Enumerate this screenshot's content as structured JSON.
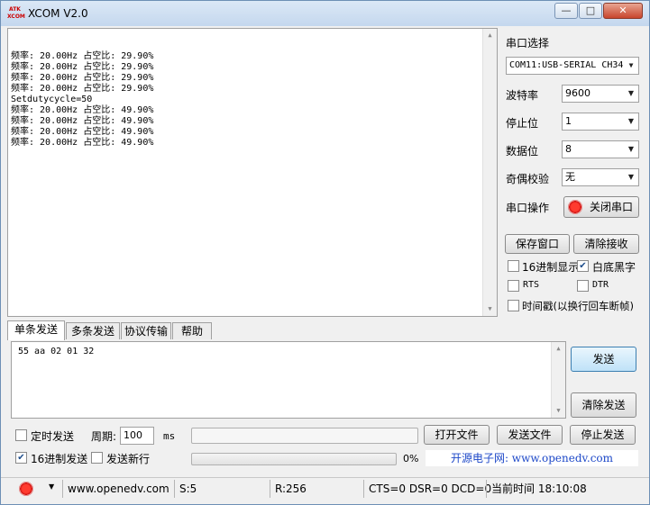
{
  "window": {
    "title": "XCOM V2.0",
    "logo_text": "ATK XCOM",
    "minimize_icon": "minimize-icon",
    "maximize_icon": "maximize-icon",
    "close_icon": "close-icon",
    "minimize_glyph": "—",
    "maximize_glyph": "□",
    "close_glyph": "✕"
  },
  "receive": {
    "lines": [
      "频率: 20.00Hz 占空比: 29.90%",
      "频率: 20.00Hz 占空比: 29.90%",
      "频率: 20.00Hz 占空比: 29.90%",
      "频率: 20.00Hz 占空比: 29.90%",
      "Setdutycycle=50",
      "频率: 20.00Hz 占空比: 49.90%",
      "频率: 20.00Hz 占空比: 49.90%",
      "频率: 20.00Hz 占空比: 49.90%",
      "频率: 20.00Hz 占空比: 49.90%"
    ]
  },
  "settings": {
    "port_select_label": "串口选择",
    "port_value": "COM11:USB-SERIAL CH34",
    "baud_label": "波特率",
    "baud_value": "9600",
    "stopbit_label": "停止位",
    "stopbit_value": "1",
    "databit_label": "数据位",
    "databit_value": "8",
    "parity_label": "奇偶校验",
    "parity_value": "无",
    "port_op_label": "串口操作",
    "close_port_button": "关闭串口",
    "save_window_button": "保存窗口",
    "clear_receive_button": "清除接收",
    "hex_display_label": "16进制显示",
    "hex_display_checked": false,
    "white_bg_label": "白底黑字",
    "white_bg_checked": true,
    "rts_label": "RTS",
    "rts_checked": false,
    "dtr_label": "DTR",
    "dtr_checked": false,
    "timestamp_label": "时间戳(以换行回车断帧)",
    "timestamp_checked": false
  },
  "tabs": [
    {
      "label": "单条发送",
      "active": true
    },
    {
      "label": "多条发送",
      "active": false
    },
    {
      "label": "协议传输",
      "active": false
    },
    {
      "label": "帮助",
      "active": false
    }
  ],
  "send": {
    "content": "55 aa 02 01 32",
    "send_button": "发送",
    "clear_send_button": "清除发送"
  },
  "bottom": {
    "timed_send_label": "定时发送",
    "timed_send_checked": false,
    "period_label": "周期:",
    "period_value": "100",
    "period_unit": "ms",
    "open_file_button": "打开文件",
    "send_file_button": "发送文件",
    "stop_send_button": "停止发送",
    "hex_send_label": "16进制发送",
    "hex_send_checked": true,
    "send_newline_label": "发送新行",
    "send_newline_checked": false,
    "progress_percent": "0%",
    "progress_value": 0,
    "ad_text": "开源电子网: www.openedv.com"
  },
  "status": {
    "website": "www.openedv.com",
    "sent": "S:5",
    "received": "R:256",
    "signals": "CTS=0 DSR=0 DCD=0",
    "time": "当前时间 18:10:08"
  }
}
